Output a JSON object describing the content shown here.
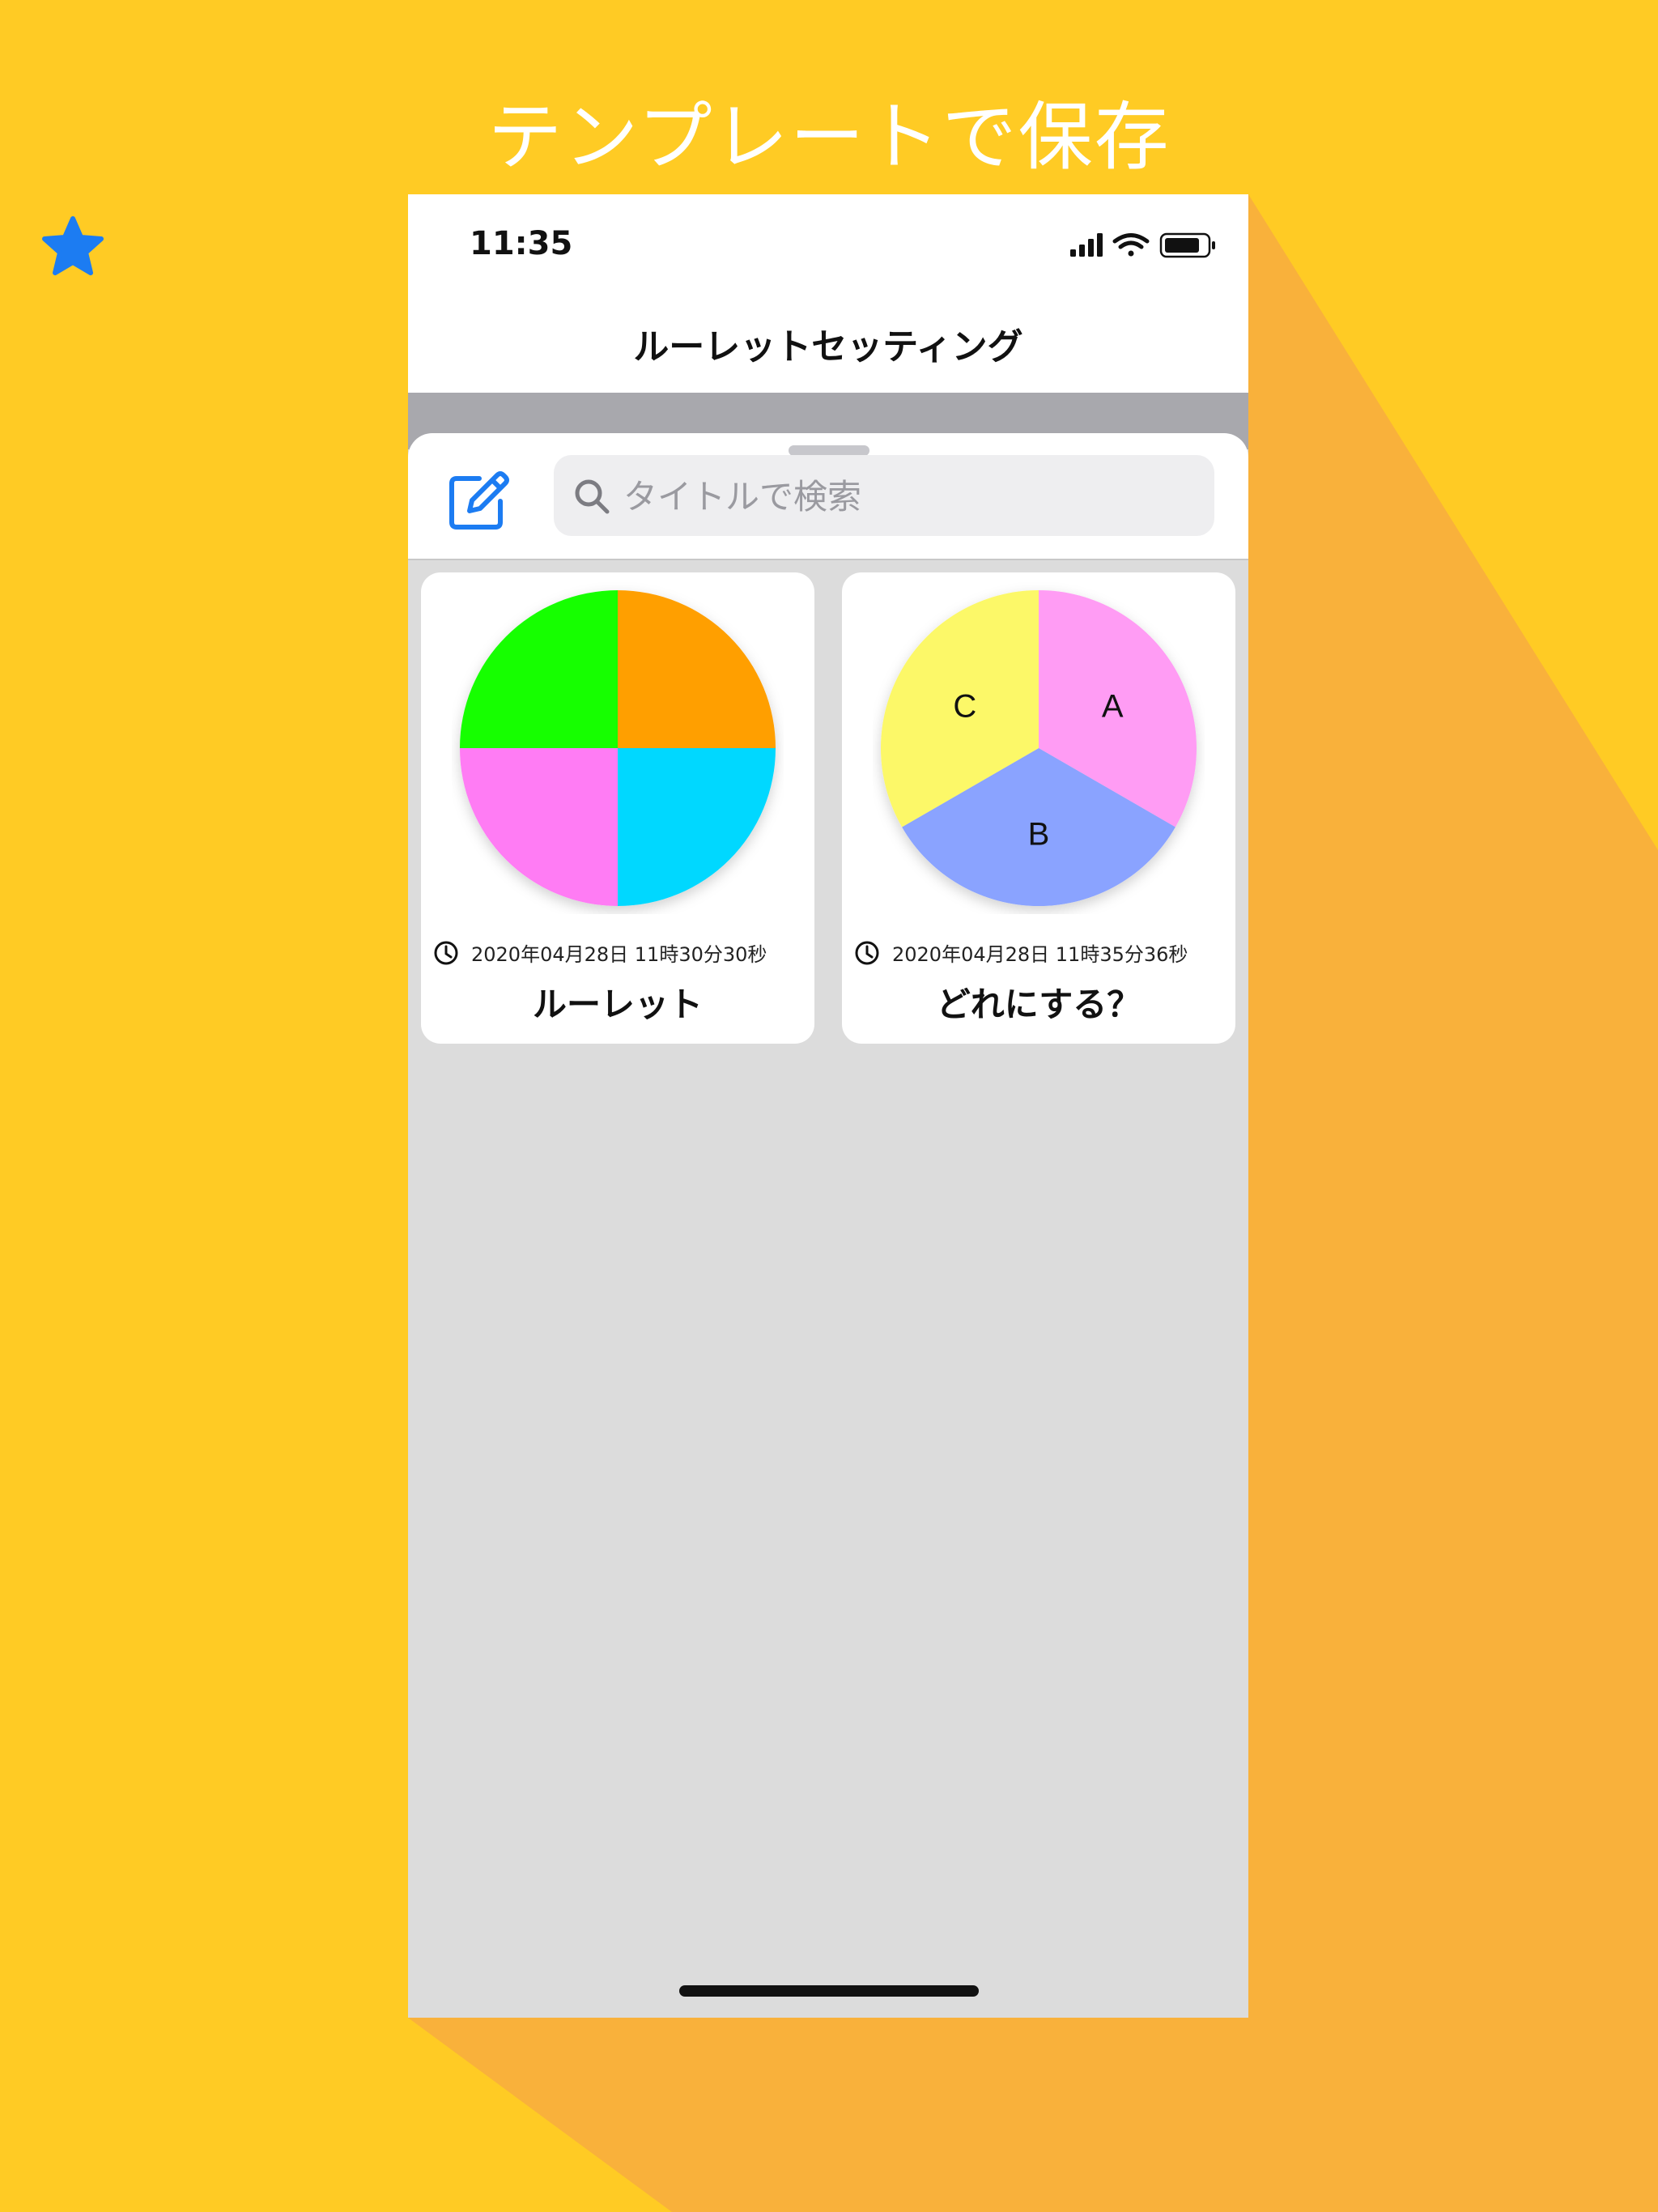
{
  "headline": "テンプレートで保存",
  "colors": {
    "background": "#FFCB24",
    "shadow": "#F9B13B",
    "accent": "#1C7CF2"
  },
  "status_bar": {
    "time": "11:35"
  },
  "nav": {
    "title": "ルーレットセッティング",
    "favorite_icon": "star-icon"
  },
  "search": {
    "placeholder": "タイトルで検索",
    "value": "",
    "icon": "search-icon"
  },
  "toolbar": {
    "edit_icon": "edit-icon"
  },
  "cards": [
    {
      "date": "2020年04月28日 11時30分30秒",
      "title": "ルーレット",
      "segments": [
        {
          "label": "",
          "color": "#FF9F00",
          "value": 1
        },
        {
          "label": "",
          "color": "#00D8FF",
          "value": 1
        },
        {
          "label": "",
          "color": "#FF7BF4",
          "value": 1
        },
        {
          "label": "",
          "color": "#14FF00",
          "value": 1
        }
      ]
    },
    {
      "date": "2020年04月28日 11時35分36秒",
      "title": "どれにする？",
      "segments": [
        {
          "label": "A",
          "color": "#FF9CF4",
          "value": 1
        },
        {
          "label": "B",
          "color": "#8AA3FF",
          "value": 1
        },
        {
          "label": "C",
          "color": "#FCF867",
          "value": 1
        }
      ]
    }
  ]
}
